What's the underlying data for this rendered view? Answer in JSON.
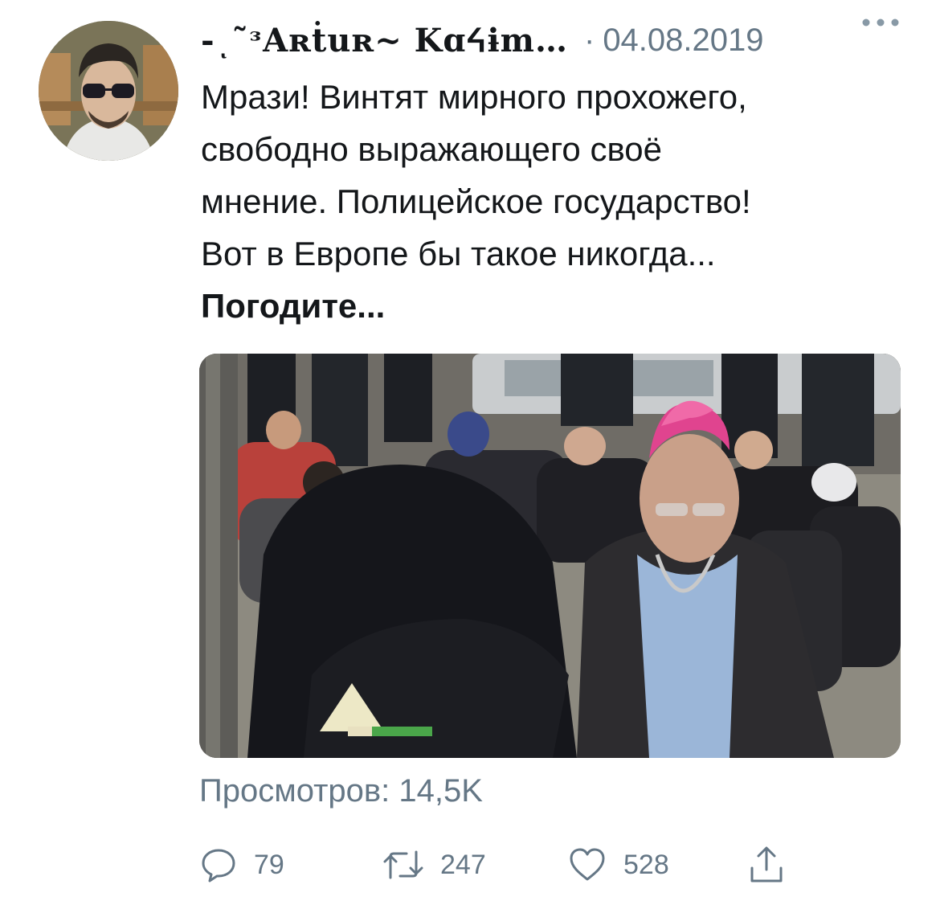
{
  "tweet": {
    "author_name": "-ͺ˜ᵌAʀṫuʀ~ Kɑᔦɨm…",
    "separator": "·",
    "date": "04.08.2019",
    "text_lines": [
      "Мрази! Винтят мирного прохожего,",
      "свободно выражающего своё",
      "мнение. Полицейское государство!",
      "Вот в Европе бы такое никогда..."
    ],
    "text_bold": "Погодите...",
    "views": "Просмотров: 14,5K"
  },
  "actions": {
    "reply_count": "79",
    "retweet_count": "247",
    "like_count": "528"
  },
  "icons": {
    "more": "more-horizontal-icon",
    "reply": "reply-bubble-icon",
    "retweet": "retweet-icon",
    "like": "heart-icon",
    "share": "share-icon"
  },
  "colors": {
    "text": "#14171a",
    "muted": "#657786",
    "background": "#ffffff"
  }
}
